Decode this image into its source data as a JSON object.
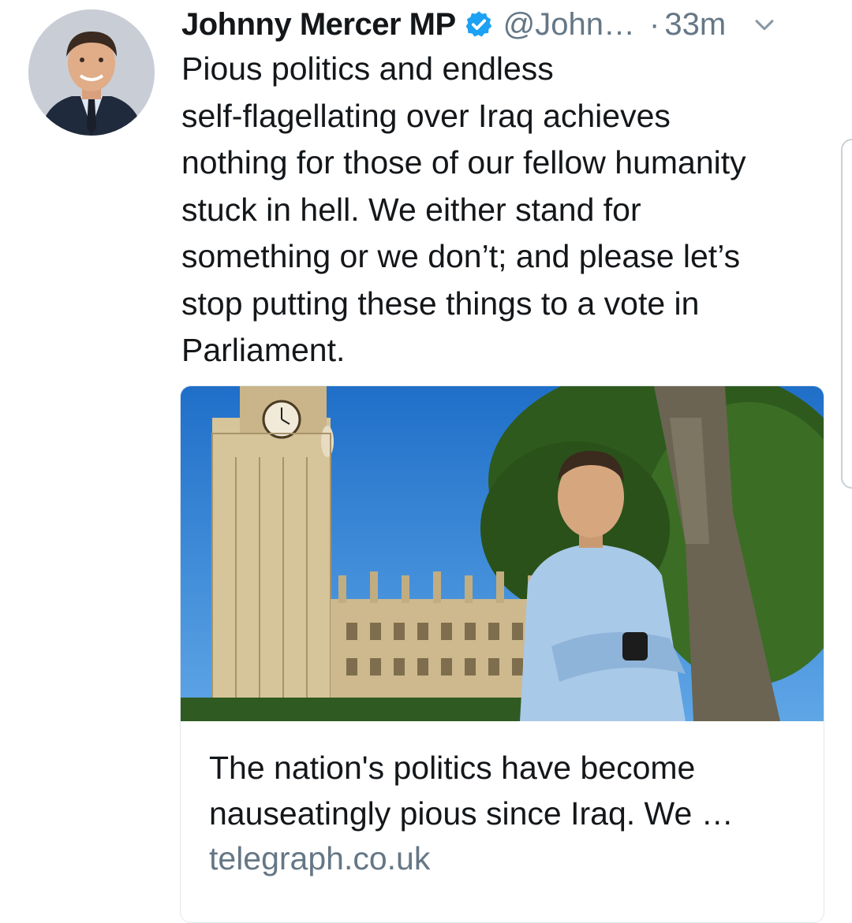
{
  "tweet": {
    "author_name": "Johnny Mercer MP",
    "handle": "@John…",
    "separator": "·",
    "time": "33m",
    "text": "Pious politics and endless\nself-flagellating over Iraq achieves\nnothing for those of our fellow humanity\nstuck in hell. We either stand for\nsomething or we don’t; and please let’s\nstop putting these things to a vote in\nParliament.",
    "icons": {
      "verified": "verified-badge-icon",
      "menu": "chevron-down-icon"
    }
  },
  "card": {
    "title": "The nation's politics have become\nnauseatingly pious since Iraq. We …",
    "domain": "telegraph.co.uk"
  },
  "colors": {
    "verified_blue": "#1da1f2",
    "secondary_text": "#657786",
    "primary_text": "#14171a",
    "card_border": "#e1e8ed"
  }
}
